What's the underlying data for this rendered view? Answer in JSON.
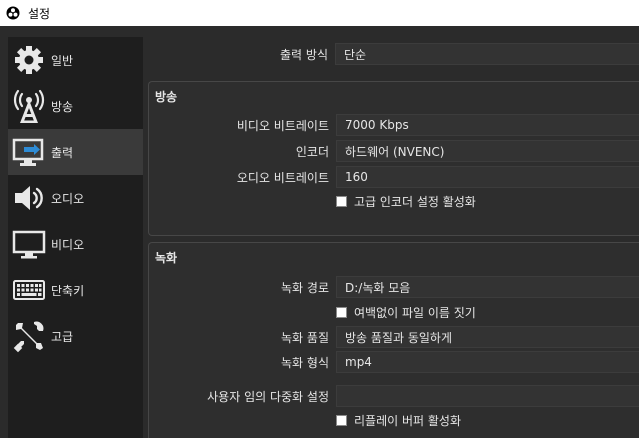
{
  "window": {
    "title": "설정"
  },
  "sidebar": {
    "items": [
      {
        "label": "일반",
        "icon": "gear-icon"
      },
      {
        "label": "방송",
        "icon": "broadcast-antenna-icon"
      },
      {
        "label": "출력",
        "icon": "output-monitor-icon",
        "selected": true
      },
      {
        "label": "오디오",
        "icon": "speaker-icon"
      },
      {
        "label": "비디오",
        "icon": "monitor-icon"
      },
      {
        "label": "단축키",
        "icon": "keyboard-icon"
      },
      {
        "label": "고급",
        "icon": "tools-icon"
      }
    ]
  },
  "output": {
    "mode_label": "출력 방식",
    "mode_value": "단순"
  },
  "streaming": {
    "title": "방송",
    "video_bitrate_label": "비디오 비트레이트",
    "video_bitrate_value": "7000 Kbps",
    "encoder_label": "인코더",
    "encoder_value": "하드웨어 (NVENC)",
    "audio_bitrate_label": "오디오 비트레이트",
    "audio_bitrate_value": "160",
    "advanced_encoder_label": "고급 인코더 설정 활성화",
    "advanced_encoder_checked": false
  },
  "recording": {
    "title": "녹화",
    "path_label": "녹화 경로",
    "path_value": "D:/녹화 모음",
    "no_space_label": "여백없이 파일 이름 짓기",
    "no_space_checked": false,
    "quality_label": "녹화 품질",
    "quality_value": "방송 품질과 동일하게",
    "format_label": "녹화 형식",
    "format_value": "mp4",
    "muxer_label": "사용자 임의 다중화 설정",
    "muxer_value": "",
    "replay_buffer_label": "리플레이 버퍼 활성화",
    "replay_buffer_checked": false
  }
}
